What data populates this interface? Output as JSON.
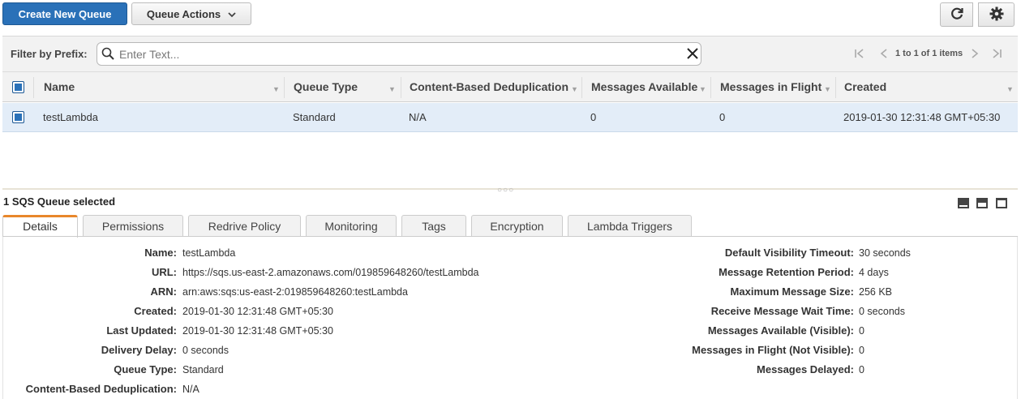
{
  "toolbar": {
    "create_label": "Create New Queue",
    "actions_label": "Queue Actions",
    "refresh_icon": "refresh-icon",
    "settings_icon": "gear-icon"
  },
  "filter": {
    "label": "Filter by Prefix:",
    "placeholder": "Enter Text...",
    "value": ""
  },
  "pagination": {
    "text": "1 to 1 of 1 items"
  },
  "table": {
    "columns": [
      "Name",
      "Queue Type",
      "Content-Based Deduplication",
      "Messages Available",
      "Messages in Flight",
      "Created"
    ],
    "rows": [
      [
        "testLambda",
        "Standard",
        "N/A",
        "0",
        "0",
        "2019-01-30 12:31:48 GMT+05:30"
      ]
    ]
  },
  "panel": {
    "selected_text": "1 SQS Queue selected",
    "tabs": [
      "Details",
      "Permissions",
      "Redrive Policy",
      "Monitoring",
      "Tags",
      "Encryption",
      "Lambda Triggers"
    ],
    "active_tab": "Details"
  },
  "details": {
    "left": [
      {
        "label": "Name:",
        "value": "testLambda"
      },
      {
        "label": "URL:",
        "value": "https://sqs.us-east-2.amazonaws.com/019859648260/testLambda"
      },
      {
        "label": "ARN:",
        "value": "arn:aws:sqs:us-east-2:019859648260:testLambda"
      },
      {
        "label": "Created:",
        "value": "2019-01-30 12:31:48 GMT+05:30"
      },
      {
        "label": "Last Updated:",
        "value": "2019-01-30 12:31:48 GMT+05:30"
      },
      {
        "label": "Delivery Delay:",
        "value": "0 seconds"
      },
      {
        "label": "Queue Type:",
        "value": "Standard"
      },
      {
        "label": "Content-Based Deduplication:",
        "value": "N/A"
      }
    ],
    "right": [
      {
        "label": "Default Visibility Timeout:",
        "value": "30 seconds"
      },
      {
        "label": "Message Retention Period:",
        "value": "4 days"
      },
      {
        "label": "Maximum Message Size:",
        "value": "256 KB"
      },
      {
        "label": "Receive Message Wait Time:",
        "value": "0 seconds"
      },
      {
        "label": "Messages Available (Visible):",
        "value": "0"
      },
      {
        "label": "Messages in Flight (Not Visible):",
        "value": "0"
      },
      {
        "label": "Messages Delayed:",
        "value": "0"
      }
    ]
  },
  "colors": {
    "primary": "#2a71b8",
    "selected_row": "#e3edf8",
    "active_tab_accent": "#e8872b"
  }
}
